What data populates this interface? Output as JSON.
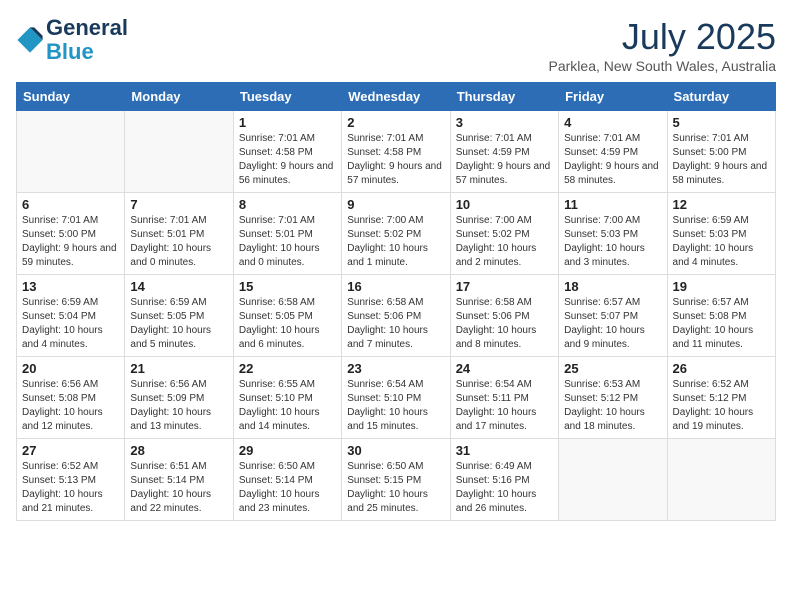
{
  "header": {
    "logo_line1": "General",
    "logo_line2": "Blue",
    "month": "July 2025",
    "location": "Parklea, New South Wales, Australia"
  },
  "days_of_week": [
    "Sunday",
    "Monday",
    "Tuesday",
    "Wednesday",
    "Thursday",
    "Friday",
    "Saturday"
  ],
  "weeks": [
    [
      {
        "day": "",
        "info": ""
      },
      {
        "day": "",
        "info": ""
      },
      {
        "day": "1",
        "info": "Sunrise: 7:01 AM\nSunset: 4:58 PM\nDaylight: 9 hours and 56 minutes."
      },
      {
        "day": "2",
        "info": "Sunrise: 7:01 AM\nSunset: 4:58 PM\nDaylight: 9 hours and 57 minutes."
      },
      {
        "day": "3",
        "info": "Sunrise: 7:01 AM\nSunset: 4:59 PM\nDaylight: 9 hours and 57 minutes."
      },
      {
        "day": "4",
        "info": "Sunrise: 7:01 AM\nSunset: 4:59 PM\nDaylight: 9 hours and 58 minutes."
      },
      {
        "day": "5",
        "info": "Sunrise: 7:01 AM\nSunset: 5:00 PM\nDaylight: 9 hours and 58 minutes."
      }
    ],
    [
      {
        "day": "6",
        "info": "Sunrise: 7:01 AM\nSunset: 5:00 PM\nDaylight: 9 hours and 59 minutes."
      },
      {
        "day": "7",
        "info": "Sunrise: 7:01 AM\nSunset: 5:01 PM\nDaylight: 10 hours and 0 minutes."
      },
      {
        "day": "8",
        "info": "Sunrise: 7:01 AM\nSunset: 5:01 PM\nDaylight: 10 hours and 0 minutes."
      },
      {
        "day": "9",
        "info": "Sunrise: 7:00 AM\nSunset: 5:02 PM\nDaylight: 10 hours and 1 minute."
      },
      {
        "day": "10",
        "info": "Sunrise: 7:00 AM\nSunset: 5:02 PM\nDaylight: 10 hours and 2 minutes."
      },
      {
        "day": "11",
        "info": "Sunrise: 7:00 AM\nSunset: 5:03 PM\nDaylight: 10 hours and 3 minutes."
      },
      {
        "day": "12",
        "info": "Sunrise: 6:59 AM\nSunset: 5:03 PM\nDaylight: 10 hours and 4 minutes."
      }
    ],
    [
      {
        "day": "13",
        "info": "Sunrise: 6:59 AM\nSunset: 5:04 PM\nDaylight: 10 hours and 4 minutes."
      },
      {
        "day": "14",
        "info": "Sunrise: 6:59 AM\nSunset: 5:05 PM\nDaylight: 10 hours and 5 minutes."
      },
      {
        "day": "15",
        "info": "Sunrise: 6:58 AM\nSunset: 5:05 PM\nDaylight: 10 hours and 6 minutes."
      },
      {
        "day": "16",
        "info": "Sunrise: 6:58 AM\nSunset: 5:06 PM\nDaylight: 10 hours and 7 minutes."
      },
      {
        "day": "17",
        "info": "Sunrise: 6:58 AM\nSunset: 5:06 PM\nDaylight: 10 hours and 8 minutes."
      },
      {
        "day": "18",
        "info": "Sunrise: 6:57 AM\nSunset: 5:07 PM\nDaylight: 10 hours and 9 minutes."
      },
      {
        "day": "19",
        "info": "Sunrise: 6:57 AM\nSunset: 5:08 PM\nDaylight: 10 hours and 11 minutes."
      }
    ],
    [
      {
        "day": "20",
        "info": "Sunrise: 6:56 AM\nSunset: 5:08 PM\nDaylight: 10 hours and 12 minutes."
      },
      {
        "day": "21",
        "info": "Sunrise: 6:56 AM\nSunset: 5:09 PM\nDaylight: 10 hours and 13 minutes."
      },
      {
        "day": "22",
        "info": "Sunrise: 6:55 AM\nSunset: 5:10 PM\nDaylight: 10 hours and 14 minutes."
      },
      {
        "day": "23",
        "info": "Sunrise: 6:54 AM\nSunset: 5:10 PM\nDaylight: 10 hours and 15 minutes."
      },
      {
        "day": "24",
        "info": "Sunrise: 6:54 AM\nSunset: 5:11 PM\nDaylight: 10 hours and 17 minutes."
      },
      {
        "day": "25",
        "info": "Sunrise: 6:53 AM\nSunset: 5:12 PM\nDaylight: 10 hours and 18 minutes."
      },
      {
        "day": "26",
        "info": "Sunrise: 6:52 AM\nSunset: 5:12 PM\nDaylight: 10 hours and 19 minutes."
      }
    ],
    [
      {
        "day": "27",
        "info": "Sunrise: 6:52 AM\nSunset: 5:13 PM\nDaylight: 10 hours and 21 minutes."
      },
      {
        "day": "28",
        "info": "Sunrise: 6:51 AM\nSunset: 5:14 PM\nDaylight: 10 hours and 22 minutes."
      },
      {
        "day": "29",
        "info": "Sunrise: 6:50 AM\nSunset: 5:14 PM\nDaylight: 10 hours and 23 minutes."
      },
      {
        "day": "30",
        "info": "Sunrise: 6:50 AM\nSunset: 5:15 PM\nDaylight: 10 hours and 25 minutes."
      },
      {
        "day": "31",
        "info": "Sunrise: 6:49 AM\nSunset: 5:16 PM\nDaylight: 10 hours and 26 minutes."
      },
      {
        "day": "",
        "info": ""
      },
      {
        "day": "",
        "info": ""
      }
    ]
  ]
}
